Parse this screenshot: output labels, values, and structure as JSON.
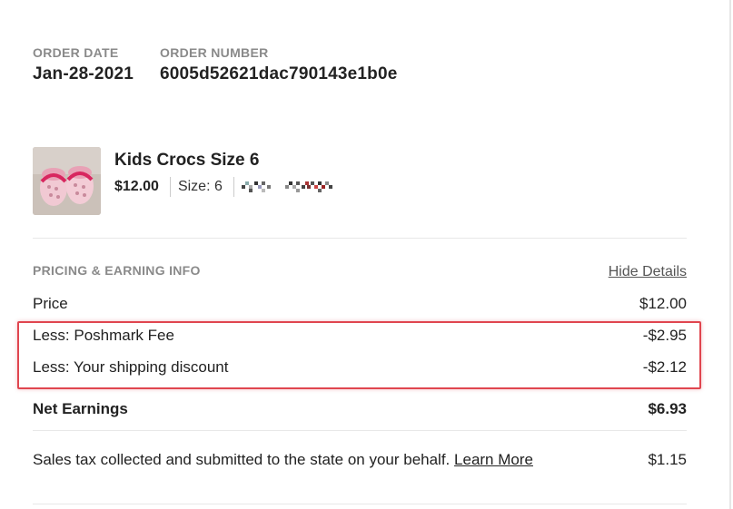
{
  "order": {
    "date_label": "ORDER DATE",
    "date_value": "Jan-28-2021",
    "number_label": "ORDER NUMBER",
    "number_value": "6005d52621dac790143e1b0e"
  },
  "product": {
    "title": "Kids Crocs Size 6",
    "price": "$12.00",
    "size": "Size: 6",
    "image_icon": "crocs-photo"
  },
  "pricing": {
    "section_label": "PRICING & EARNING INFO",
    "toggle_label": "Hide Details",
    "rows": [
      {
        "label": "Price",
        "value": "$12.00"
      },
      {
        "label": "Less: Poshmark Fee",
        "value": "-$2.95"
      },
      {
        "label": "Less: Your shipping discount",
        "value": "-$2.12"
      }
    ],
    "net_label": "Net Earnings",
    "net_value": "$6.93",
    "tax_text": "Sales tax collected and submitted to the state on your behalf.",
    "tax_link": "Learn More",
    "tax_value": "$1.15"
  },
  "colors": {
    "highlight": "#e0464f",
    "label_gray": "#8a8a8a"
  }
}
